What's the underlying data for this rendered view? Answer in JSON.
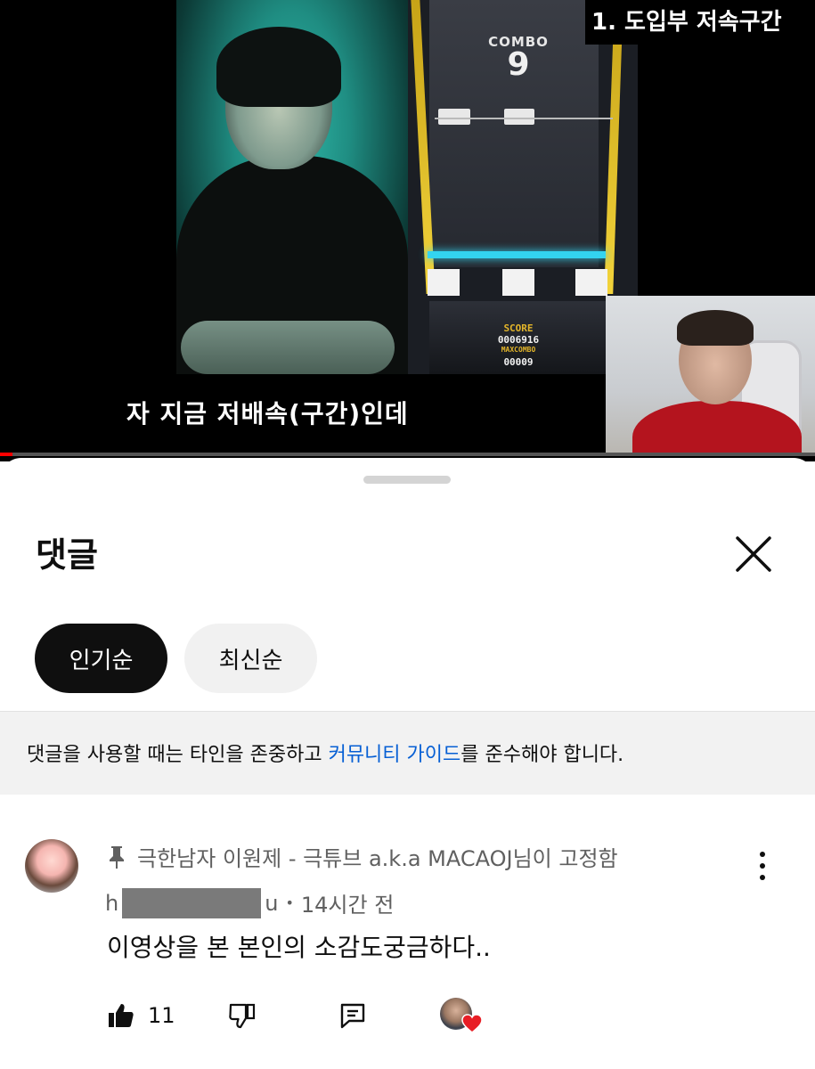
{
  "video": {
    "chapter_title": "1. 도입부 저속구간",
    "subtitle": "자 지금 저배속(구간)인데",
    "game": {
      "combo_label": "COMBO",
      "combo_value": "9",
      "score_label": "SCORE",
      "score_value": "0006916",
      "maxcombo_label": "MAXCOMBO",
      "maxcombo_value": "00009"
    },
    "progress_fraction": 0.015
  },
  "comments_panel": {
    "title": "댓글",
    "sort_chips": [
      {
        "label": "인기순",
        "active": true
      },
      {
        "label": "최신순",
        "active": false
      }
    ],
    "guideline": {
      "before_link": "댓글을 사용할 때는 타인을 존중하고 ",
      "link_text": "커뮤니티 가이드",
      "after_link": "를 준수해야 합니다."
    },
    "comment": {
      "pinned_by": "극한남자 이원제 - 극튜브 a.k.a MACAOJ님이 고정함",
      "author_prefix": "h",
      "author_suffix": "u",
      "separator": "•",
      "time": "14시간 전",
      "text": "이영상을 본 본인의 소감도궁금하다..",
      "like_count": "11"
    }
  },
  "colors": {
    "accent_link": "#065fd4",
    "progress_red": "#ff0000",
    "heart_red": "#e81e25",
    "chip_active_bg": "#0f0f0f"
  },
  "icons": [
    "pin-icon",
    "close-icon",
    "more-vert-icon",
    "like-icon",
    "dislike-icon",
    "reply-icon",
    "heart-icon"
  ]
}
